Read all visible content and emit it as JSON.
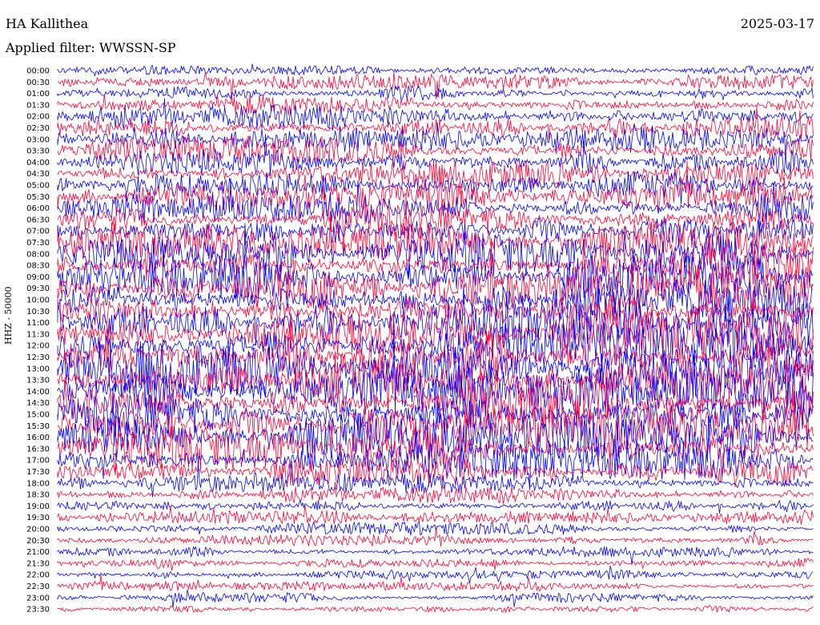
{
  "header": {
    "station": "HA Kallithea",
    "date": "2025-03-17",
    "filter": "Applied filter: WWSSN-SP",
    "channel_label": "HHZ - 50000"
  },
  "colors": {
    "trace_a": "#0000ff",
    "trace_b": "#ff0033",
    "background": "#ffffff",
    "text": "#000000"
  },
  "chart_data": {
    "type": "line",
    "title": "HA Kallithea",
    "subtitle": "Applied filter: WWSSN-SP",
    "ylabel": "HHZ - 50000",
    "xlabel": "",
    "grid": false,
    "legend": "none",
    "row_times": [
      "00:00",
      "00:30",
      "01:00",
      "01:30",
      "02:00",
      "02:30",
      "03:00",
      "03:30",
      "04:00",
      "04:30",
      "05:00",
      "05:30",
      "06:00",
      "06:30",
      "07:00",
      "07:30",
      "08:00",
      "08:30",
      "09:00",
      "09:30",
      "10:00",
      "10:30",
      "11:00",
      "11:30",
      "12:00",
      "12:30",
      "13:00",
      "13:30",
      "14:00",
      "14:30",
      "15:00",
      "15:30",
      "16:00",
      "16:30",
      "17:00",
      "17:30",
      "18:00",
      "18:30",
      "19:00",
      "19:30",
      "20:00",
      "20:30",
      "21:00",
      "21:30",
      "22:00",
      "22:30",
      "23:00",
      "23:30"
    ],
    "row_colors": [
      "blue",
      "red"
    ],
    "row_amplitude": [
      0.6,
      0.9,
      1.0,
      1.3,
      1.6,
      1.7,
      1.8,
      1.7,
      1.6,
      1.6,
      1.7,
      1.8,
      1.9,
      2.0,
      2.1,
      2.3,
      2.5,
      2.6,
      2.8,
      2.9,
      3.0,
      3.0,
      3.1,
      3.1,
      3.2,
      3.2,
      3.2,
      3.1,
      3.1,
      3.0,
      3.0,
      2.9,
      2.8,
      2.6,
      2.3,
      1.8,
      1.3,
      1.1,
      1.0,
      0.9,
      0.8,
      0.7,
      0.6,
      0.6,
      0.6,
      0.6,
      0.6,
      0.6
    ]
  }
}
